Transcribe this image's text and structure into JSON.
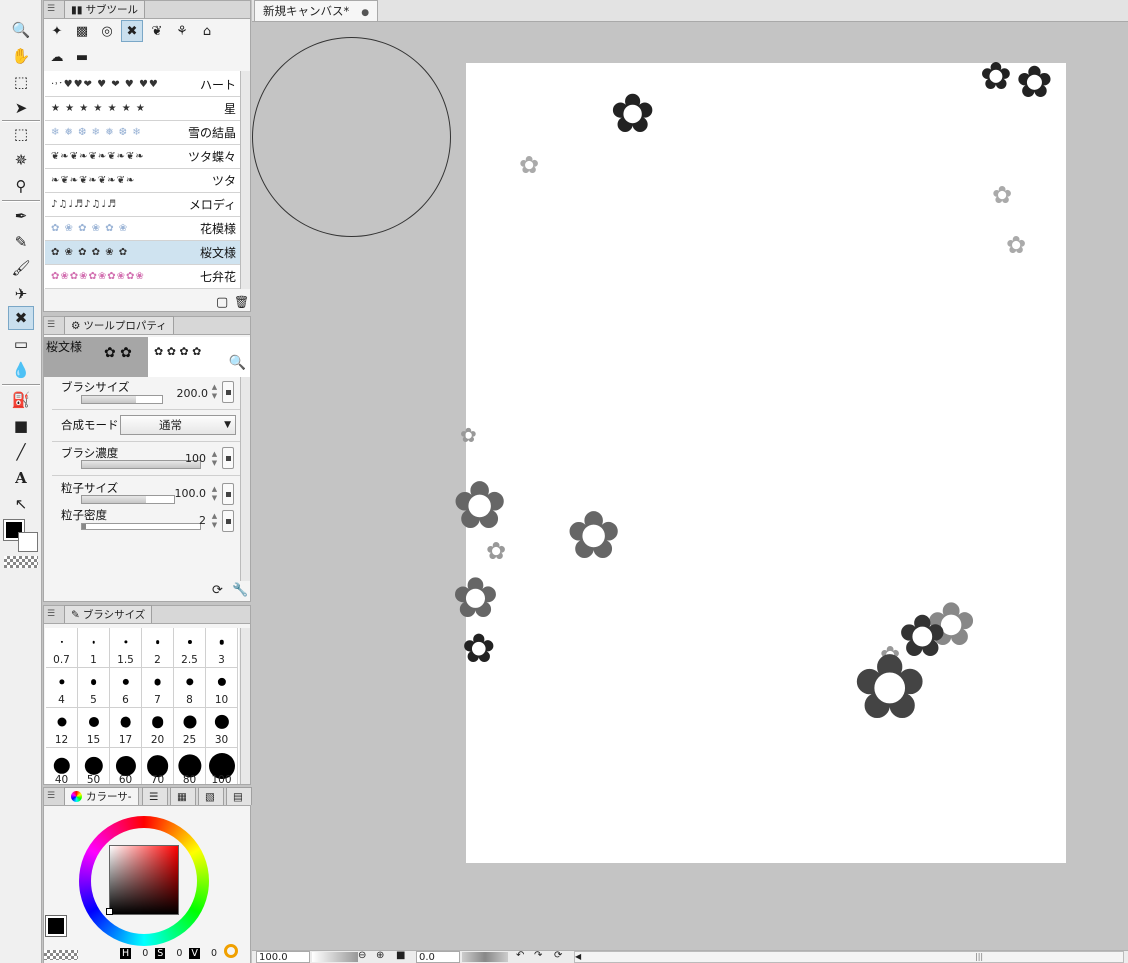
{
  "canvas": {
    "tab_title": "新規キャンバス*",
    "zoom": "100.0",
    "rotation": "0.0"
  },
  "subtool_panel": {
    "tab": "サブツール",
    "brushes": [
      {
        "preview": "·˒ˑ♥♥❤ ♥ ❤ ♥ ♥♥",
        "name": "ハート"
      },
      {
        "preview": "★ ★ ★ ★ ★ ★ ★",
        "name": "星"
      },
      {
        "preview": "❄ ❅ ❆ ❄ ❅ ❆ ❄",
        "name": "雪の結晶"
      },
      {
        "preview": "❦❧❦❧❦❧❦❧❦❧",
        "name": "ツタ蝶々"
      },
      {
        "preview": "❧❦❧❦❧❦❧❦❧",
        "name": "ツタ"
      },
      {
        "preview": "♪♫♩♬♪♫♩♬",
        "name": "メロディ"
      },
      {
        "preview": "✿ ❀ ✿ ❀ ✿ ❀",
        "name": "花模様"
      },
      {
        "preview": "✿ ❀ ✿ ✿ ❀ ✿",
        "name": "桜文様"
      },
      {
        "preview": "✿❀✿❀✿❀✿❀✿❀",
        "name": "七弁花"
      }
    ]
  },
  "tool_property": {
    "tab": "ツールプロパティ",
    "brush_name": "桜文様",
    "brush_size": {
      "label": "ブラシサイズ",
      "value": "200.0",
      "fill": 0.68
    },
    "blend_mode": {
      "label": "合成モード",
      "value": "通常"
    },
    "brush_density": {
      "label": "ブラシ濃度",
      "value": "100",
      "fill": 1.0
    },
    "particle_size": {
      "label": "粒子サイズ",
      "value": "100.0",
      "fill": 0.7
    },
    "particle_density": {
      "label": "粒子密度",
      "value": "2",
      "fill": 0.02
    }
  },
  "brush_size_panel": {
    "tab": "ブラシサイズ",
    "sizes": [
      "0.7",
      "1",
      "1.5",
      "2",
      "2.5",
      "3",
      "4",
      "5",
      "6",
      "7",
      "8",
      "10",
      "12",
      "15",
      "17",
      "20",
      "25",
      "30",
      "40",
      "50",
      "60",
      "70",
      "80",
      "100"
    ]
  },
  "color_panel": {
    "tab": "カラーサ-",
    "h_label": "H",
    "h_value": "0",
    "s_label": "S",
    "s_value": "0",
    "v_label": "V",
    "v_value": "0"
  },
  "colors": {
    "selection": "#c9dfee",
    "panel_bg": "#f4f4f4",
    "workspace": "#c4c4c4"
  }
}
